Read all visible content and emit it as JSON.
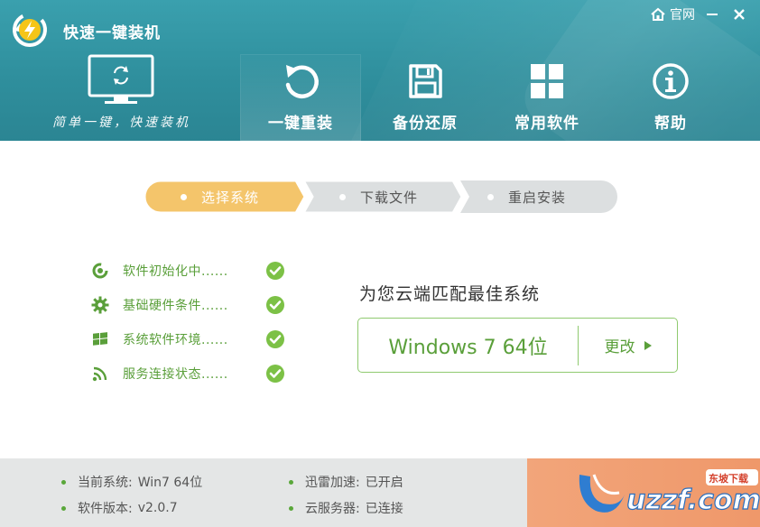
{
  "app": {
    "title": "快速一键装机",
    "slogan": "简单一键，快速装机"
  },
  "window": {
    "site_label": "官网",
    "minimize_label": "−",
    "close_label": "✕"
  },
  "nav": [
    {
      "label": "一键重装",
      "icon": "refresh-icon",
      "active": true
    },
    {
      "label": "备份还原",
      "icon": "save-disk-icon",
      "active": false
    },
    {
      "label": "常用软件",
      "icon": "apps-grid-icon",
      "active": false
    },
    {
      "label": "帮助",
      "icon": "info-icon",
      "active": false
    }
  ],
  "steps": [
    {
      "label": "选择系统",
      "state": "active"
    },
    {
      "label": "下载文件",
      "state": "pending"
    },
    {
      "label": "重启安装",
      "state": "pending"
    }
  ],
  "checks": [
    {
      "label": "软件初始化中......",
      "icon": "init-spinner-icon",
      "status": "ok"
    },
    {
      "label": "基础硬件条件......",
      "icon": "gear-icon",
      "status": "ok"
    },
    {
      "label": "系统软件环境......",
      "icon": "windows-logo-icon",
      "status": "ok"
    },
    {
      "label": "服务连接状态......",
      "icon": "wifi-signal-icon",
      "status": "ok"
    }
  ],
  "match": {
    "title": "为您云端匹配最佳系统",
    "os": "Windows 7 64位",
    "change_label": "更改"
  },
  "footer": {
    "left": [
      {
        "key": "当前系统:",
        "value": "Win7 64位"
      },
      {
        "key": "软件版本:",
        "value": "v2.0.7"
      }
    ],
    "right": [
      {
        "key": "迅雷加速:",
        "value": "已开启"
      },
      {
        "key": "云服务器:",
        "value": "已连接"
      }
    ]
  },
  "watermark": {
    "text": "uzzf.com",
    "badge": "东坡下载"
  },
  "colors": {
    "header": "#2f8f9d",
    "step_active": "#f4c56b",
    "step_pending": "#dcdfe0",
    "accent_green": "#5a9f3a",
    "footer_bg": "#e4e6e6",
    "promo_bg": "#ef9d6e"
  }
}
